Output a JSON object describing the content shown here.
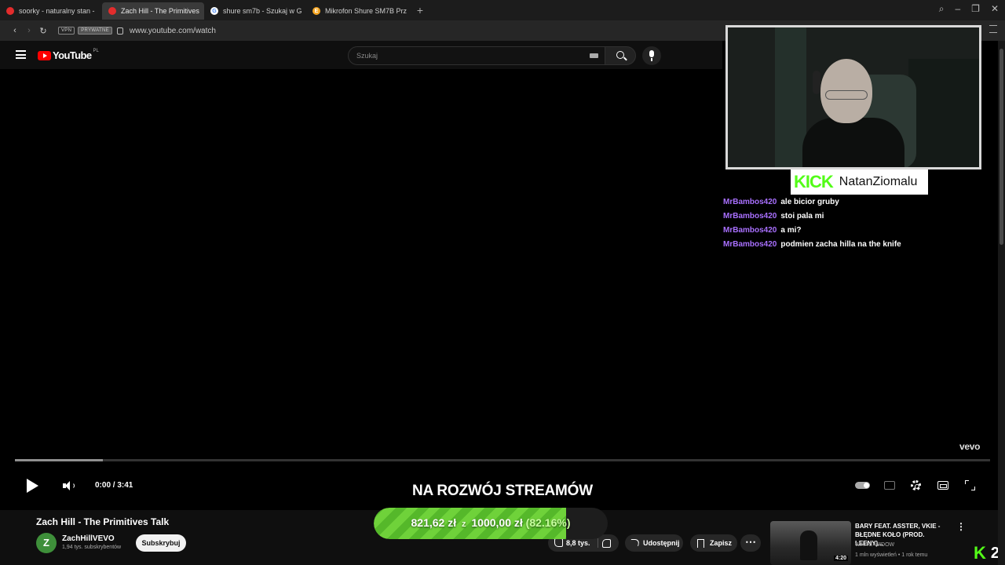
{
  "browser": {
    "tabs": [
      {
        "title": "soorky - naturalny stan -",
        "icon": "youtube-favicon",
        "active": false
      },
      {
        "title": "Zach Hill - The Primitives",
        "icon": "youtube-favicon",
        "active": true
      },
      {
        "title": "shure sm7b - Szukaj w G",
        "icon": "google-favicon",
        "active": false
      },
      {
        "title": "Mikrofon Shure SM7B Prz",
        "icon": "shop-favicon",
        "active": false
      }
    ],
    "new_tab": "+",
    "vpn_badge": "VPN",
    "private_badge": "PRYWATNE",
    "url": "www.youtube.com/watch",
    "fav_letters": {
      "google": "G",
      "shop": "E"
    }
  },
  "youtube": {
    "logo_text": "YouTube",
    "region": "PL",
    "search_placeholder": "Szukaj"
  },
  "player": {
    "time": "0:00 / 3:41",
    "watermark": "vevo",
    "buffered_fraction": 0.09
  },
  "overlay": {
    "promo": "NA ROZWÓJ STREAMÓW",
    "goal": {
      "current": "821,62 zł",
      "sep": "z",
      "target": "1000,00 zł",
      "percent": "(82.16%)",
      "fraction": 0.8216
    },
    "kick_logo": "KICK",
    "streamer": "NatanZiomalu",
    "corner_k": "K",
    "corner_num": "2",
    "chat": [
      {
        "user": "MrBambos420",
        "msg": "ale bicior gruby"
      },
      {
        "user": "MrBambos420",
        "msg": "stoi pala mi"
      },
      {
        "user": "MrBambos420",
        "msg": "a mi?"
      },
      {
        "user": "MrBambos420",
        "msg": "podmien zacha hilla na the knife"
      }
    ]
  },
  "video_info": {
    "title": "Zach Hill - The Primitives Talk",
    "avatar_letter": "Z",
    "channel": "ZachHillVEVO",
    "subscribers": "1,94 tys. subskrybentów",
    "subscribe_label": "Subskrybuj",
    "likes": "8,8 tys.",
    "share_label": "Udostępnij",
    "save_label": "Zapisz",
    "more": "⋯"
  },
  "recommended": {
    "title": "BARY FEAT. ASSTER, VKIE - BŁĘDNE KOŁO (PROD. LEENY)...",
    "channel": "WHITE WIDOW",
    "meta": "1 mln wyświetleń • 1 rok temu",
    "duration": "4:20",
    "more": "⋮"
  },
  "colors": {
    "kick_green": "#53fc18",
    "chat_user": "#a970ff",
    "youtube_red": "#ff0000"
  }
}
